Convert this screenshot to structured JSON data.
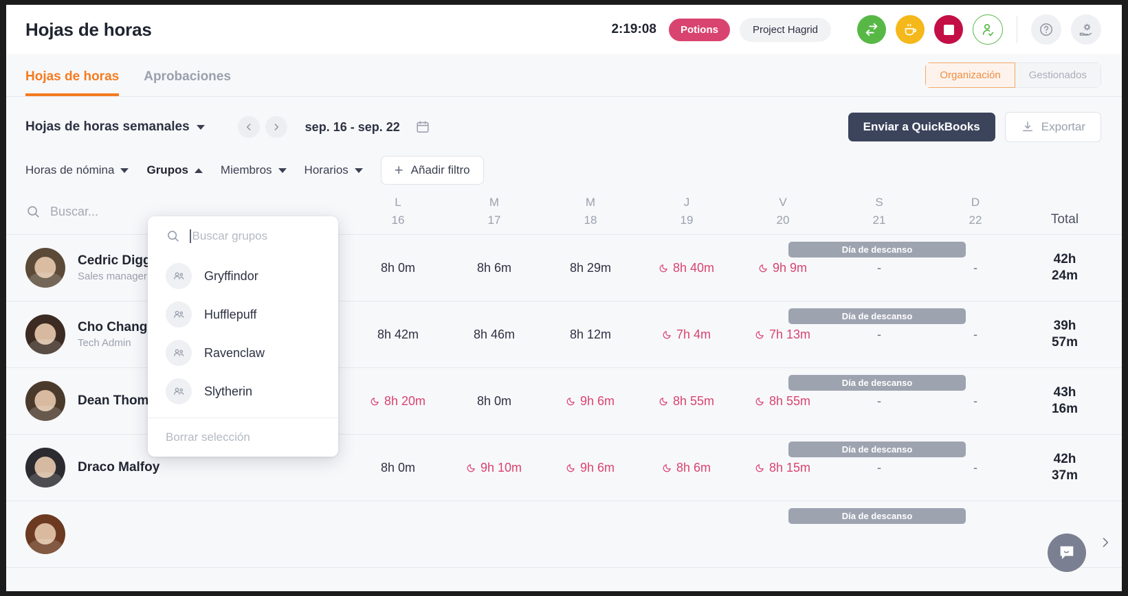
{
  "header": {
    "app_title": "Hojas de horas",
    "timer": "2:19:08",
    "tag_label": "Potions",
    "project_label": "Project Hagrid",
    "icons": {
      "switch": "switch-task-icon",
      "break": "coffee-break-icon",
      "stop": "stop-shift-icon",
      "user_status": "user-check-icon",
      "help": "help-icon",
      "support": "hand-gear-icon"
    }
  },
  "tabs": [
    {
      "label": "Hojas de horas",
      "active": true
    },
    {
      "label": "Aprobaciones",
      "active": false
    }
  ],
  "scope_toggle": {
    "options": [
      "Organización",
      "Gestionados"
    ],
    "selected": "Organización"
  },
  "controls": {
    "view_selector": "Hojas de horas semanales",
    "date_range": "sep. 16 - sep. 22",
    "send_quickbooks": "Enviar a QuickBooks",
    "export": "Exportar"
  },
  "filters": {
    "items": [
      {
        "label": "Horas de nómina",
        "open": false
      },
      {
        "label": "Grupos",
        "open": true
      },
      {
        "label": "Miembros",
        "open": false
      },
      {
        "label": "Horarios",
        "open": false
      }
    ],
    "add_filter": "Añadir filtro"
  },
  "groups_dropdown": {
    "search_placeholder": "Buscar grupos",
    "items": [
      "Gryffindor",
      "Hufflepuff",
      "Ravenclaw",
      "Slytherin"
    ],
    "clear_selection": "Borrar selección"
  },
  "table": {
    "search_placeholder": "Buscar...",
    "total_header": "Total",
    "rest_day_label": "Día de descanso",
    "empty_value": "-",
    "columns": [
      {
        "dayname": "L",
        "daynum": "16"
      },
      {
        "dayname": "M",
        "daynum": "17"
      },
      {
        "dayname": "M",
        "daynum": "18"
      },
      {
        "dayname": "J",
        "daynum": "19"
      },
      {
        "dayname": "V",
        "daynum": "20"
      },
      {
        "dayname": "S",
        "daynum": "21"
      },
      {
        "dayname": "D",
        "daynum": "22"
      }
    ],
    "rows": [
      {
        "name": "Cedric Diggory",
        "role": "Sales manager",
        "avatar_color": "#5b4a37",
        "cells": [
          {
            "value": "8h 0m",
            "alert": false
          },
          {
            "value": "8h 6m",
            "alert": false
          },
          {
            "value": "8h 29m",
            "alert": false
          },
          {
            "value": "8h 40m",
            "alert": true
          },
          {
            "value": "9h 9m",
            "alert": true
          },
          {
            "value": "-",
            "alert": false,
            "rest": true
          },
          {
            "value": "-",
            "alert": false,
            "rest": true
          }
        ],
        "total": [
          "42h",
          "24m"
        ]
      },
      {
        "name": "Cho Chang",
        "role": "Tech Admin",
        "avatar_color": "#3b2b22",
        "cells": [
          {
            "value": "8h 42m",
            "alert": false
          },
          {
            "value": "8h 46m",
            "alert": false
          },
          {
            "value": "8h 12m",
            "alert": false
          },
          {
            "value": "7h 4m",
            "alert": true
          },
          {
            "value": "7h 13m",
            "alert": true
          },
          {
            "value": "-",
            "alert": false,
            "rest": true
          },
          {
            "value": "-",
            "alert": false,
            "rest": true
          }
        ],
        "total": [
          "39h",
          "57m"
        ]
      },
      {
        "name": "Dean Thomas",
        "role": "",
        "avatar_color": "#4a3a2c",
        "cells": [
          {
            "value": "8h 20m",
            "alert": true
          },
          {
            "value": "8h 0m",
            "alert": false
          },
          {
            "value": "9h 6m",
            "alert": true
          },
          {
            "value": "8h 55m",
            "alert": true
          },
          {
            "value": "8h 55m",
            "alert": true
          },
          {
            "value": "-",
            "alert": false,
            "rest": true
          },
          {
            "value": "-",
            "alert": false,
            "rest": true
          }
        ],
        "total": [
          "43h",
          "16m"
        ]
      },
      {
        "name": "Draco Malfoy",
        "role": "",
        "avatar_color": "#2b2b30",
        "cells": [
          {
            "value": "8h 0m",
            "alert": false
          },
          {
            "value": "9h 10m",
            "alert": true
          },
          {
            "value": "9h 6m",
            "alert": true
          },
          {
            "value": "8h 6m",
            "alert": true
          },
          {
            "value": "8h 15m",
            "alert": true
          },
          {
            "value": "-",
            "alert": false,
            "rest": true
          },
          {
            "value": "-",
            "alert": false,
            "rest": true
          }
        ],
        "total": [
          "42h",
          "37m"
        ]
      },
      {
        "name": "",
        "role": "",
        "avatar_color": "#6b3a20",
        "cells": [
          {
            "value": "",
            "alert": false
          },
          {
            "value": "",
            "alert": false
          },
          {
            "value": "",
            "alert": false
          },
          {
            "value": "",
            "alert": false
          },
          {
            "value": "",
            "alert": false
          },
          {
            "value": "",
            "alert": false,
            "rest": true
          },
          {
            "value": "",
            "alert": false,
            "rest": true
          }
        ],
        "total": [
          "",
          ""
        ]
      }
    ]
  },
  "colors": {
    "accent": "#f47b20",
    "alert": "#d9436f",
    "tag": "#d9436f",
    "primary_btn": "#3c445c",
    "rest_badge": "#9ea3b0"
  },
  "chat": {
    "icon": "chat-bubble-icon",
    "expand": "chevron-right-icon"
  }
}
